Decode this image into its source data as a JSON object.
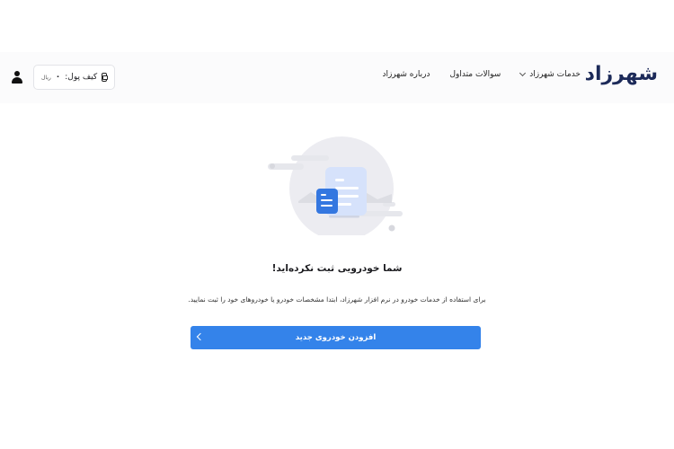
{
  "header": {
    "logo": "شهرزاد",
    "nav": [
      {
        "label": "خدمات شهرزاد",
        "has_dropdown": true
      },
      {
        "label": "سوالات متداول",
        "has_dropdown": false
      },
      {
        "label": "درباره شهرزاد",
        "has_dropdown": false
      }
    ],
    "wallet": {
      "label": "کیف پول:",
      "amount": "۰",
      "unit": "ریال"
    },
    "icons": {
      "wallet": "wallet-icon",
      "user": "user-icon",
      "dropdown": "chevron-down-icon"
    }
  },
  "empty_state": {
    "title": "شما خودرویی ثبت نکرده‌اید!",
    "description": "برای استفاده از خدمات خودرو در نرم افزار شهرزاد، ابتدا مشخصات خودرو یا خودروهای خود را ثبت نمایید.",
    "button_label": "افزودن خودروی جدید",
    "button_icon": "chevron-left-icon",
    "illustration": "empty-documents-illustration"
  },
  "colors": {
    "accent": "#3483ea",
    "logo": "#1c2a59",
    "header_bg": "#fbfbfc",
    "illustration_circle": "#ececf1",
    "document_light": "#d6e2fb",
    "document_dark": "#3477e0"
  }
}
